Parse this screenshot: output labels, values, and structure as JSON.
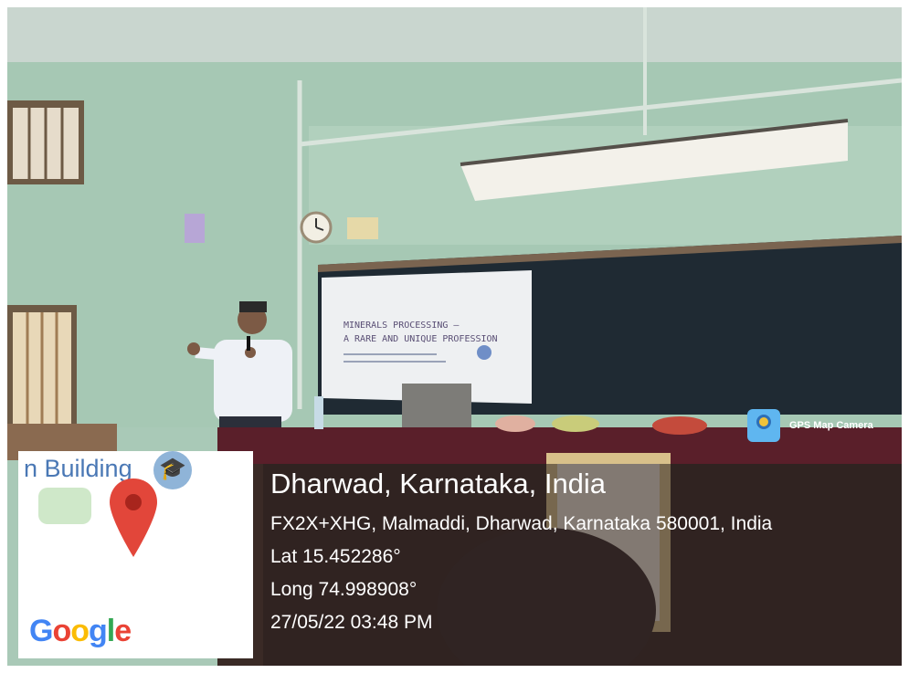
{
  "slide": {
    "title_line1": "MINERALS PROCESSING –",
    "title_line2": "A RARE AND UNIQUE PROFESSION"
  },
  "map": {
    "place_label": "n Building",
    "logo_text": [
      "G",
      "o",
      "o",
      "g",
      "l",
      "e"
    ],
    "cap_icon": "graduation-cap-icon",
    "pin_icon": "map-pin-icon"
  },
  "badge": {
    "label": "GPS Map Camera",
    "icon": "gps-map-camera-icon"
  },
  "location": {
    "title": "Dharwad, Karnataka, India",
    "address": "FX2X+XHG, Malmaddi, Dharwad, Karnataka 580001, India",
    "lat": "Lat 15.452286°",
    "long": "Long 74.998908°",
    "datetime": "27/05/22 03:48 PM"
  },
  "colors": {
    "wall": "#a9c9b7",
    "blackboard": "#1f2a33",
    "table_cloth": "#5a1f2a",
    "pin": "#e2463a"
  }
}
